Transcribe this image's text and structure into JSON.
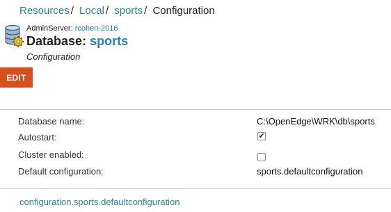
{
  "breadcrumb": {
    "items": [
      "Resources",
      "Local",
      "sports"
    ],
    "current": "Configuration",
    "separator": "/"
  },
  "header": {
    "icon": "database-gear-icon",
    "admin_label": "AdminServer:",
    "admin_server": "rcohen-2016",
    "title_prefix": "Database:",
    "title_name": "sports",
    "subtitle": "Configuration"
  },
  "toolbar": {
    "edit_label": "EDIT",
    "edit_color": "#d64f1e"
  },
  "properties": {
    "database_name": {
      "label": "Database name:",
      "value": "C:\\OpenEdge\\WRK\\db\\sports"
    },
    "autostart": {
      "label": "Autostart:",
      "checked": true
    },
    "cluster_enabled": {
      "label": "Cluster enabled:",
      "checked": false
    },
    "default_configuration": {
      "label": "Default configuration:",
      "value": "sports.defaultconfiguration"
    }
  },
  "footer": {
    "link": "configuration.sports.defaultconfiguration"
  },
  "colors": {
    "link": "#2a7fb8",
    "accent": "#d64f1e"
  }
}
